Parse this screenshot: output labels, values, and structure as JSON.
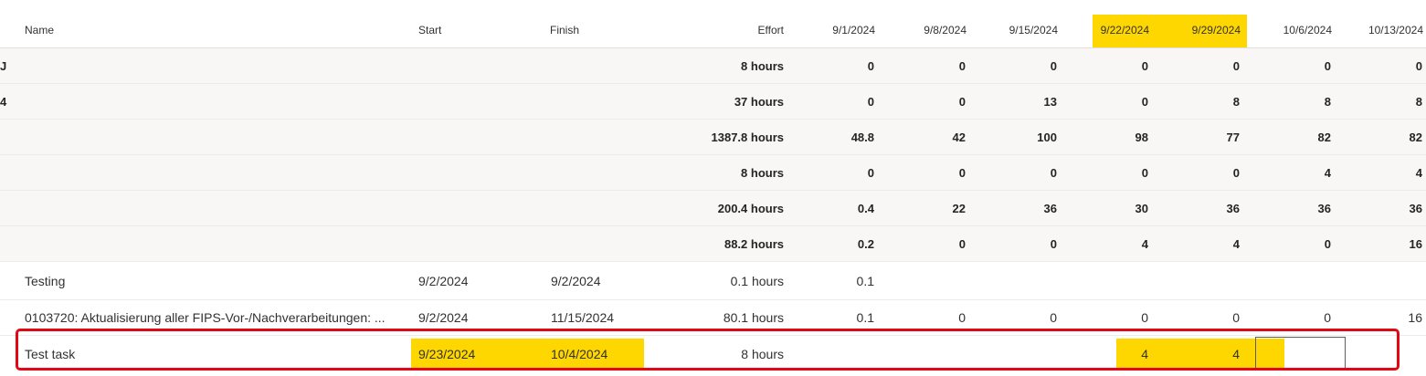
{
  "header": {
    "name": "Name",
    "start": "Start",
    "finish": "Finish",
    "effort": "Effort",
    "weeks": [
      "9/1/2024",
      "9/8/2024",
      "9/15/2024",
      "9/22/2024",
      "9/29/2024",
      "10/6/2024",
      "10/13/2024"
    ]
  },
  "highlight_color": "#ffd700",
  "selection_color": "#e30613",
  "summary_rows": [
    {
      "edge": "J",
      "effort": "8 hours",
      "w": [
        "0",
        "0",
        "0",
        "0",
        "0",
        "0",
        "0"
      ]
    },
    {
      "edge": "4",
      "effort": "37 hours",
      "w": [
        "0",
        "0",
        "13",
        "0",
        "8",
        "8",
        "8"
      ]
    },
    {
      "edge": "",
      "effort": "1387.8 hours",
      "w": [
        "48.8",
        "42",
        "100",
        "98",
        "77",
        "82",
        "82"
      ]
    },
    {
      "edge": "",
      "effort": "8 hours",
      "w": [
        "0",
        "0",
        "0",
        "0",
        "0",
        "4",
        "4"
      ]
    },
    {
      "edge": "",
      "effort": "200.4 hours",
      "w": [
        "0.4",
        "22",
        "36",
        "30",
        "36",
        "36",
        "36"
      ]
    },
    {
      "edge": "",
      "effort": "88.2 hours",
      "w": [
        "0.2",
        "0",
        "0",
        "4",
        "4",
        "0",
        "16"
      ]
    }
  ],
  "task_rows": [
    {
      "name": "Testing",
      "start": "9/2/2024",
      "finish": "9/2/2024",
      "effort": "0.1 hours",
      "w": [
        "0.1",
        "",
        "",
        "",
        "",
        "",
        ""
      ]
    },
    {
      "name": "0103720: Aktualisierung aller FIPS-Vor-/Nachverarbeitungen: ...",
      "start": "9/2/2024",
      "finish": "11/15/2024",
      "effort": "80.1 hours",
      "w": [
        "0.1",
        "0",
        "0",
        "0",
        "0",
        "0",
        "16"
      ]
    },
    {
      "name": "Test task",
      "start": "9/23/2024",
      "finish": "10/4/2024",
      "effort": "8 hours",
      "w": [
        "",
        "",
        "",
        "4",
        "4",
        "",
        ""
      ]
    }
  ]
}
